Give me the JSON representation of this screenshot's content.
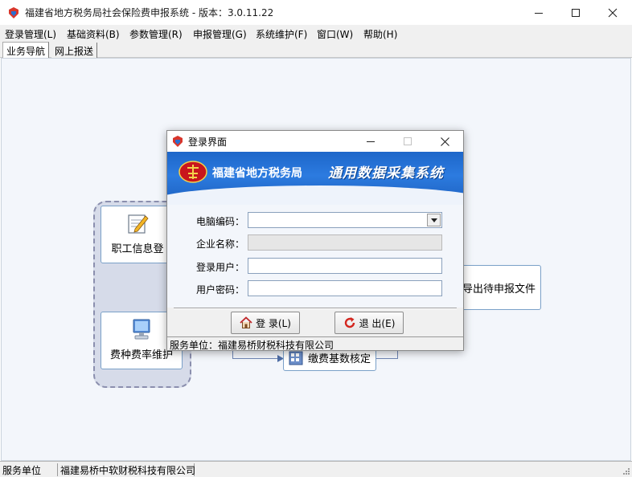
{
  "window": {
    "title": "福建省地方税务局社会保险费申报系统 - 版本：3.0.11.22"
  },
  "menu": [
    {
      "label": "登录管理(L)"
    },
    {
      "label": "基础资料(B)"
    },
    {
      "label": "参数管理(R)"
    },
    {
      "label": "申报管理(G)"
    },
    {
      "label": "系统维护(F)"
    },
    {
      "label": "窗口(W)"
    },
    {
      "label": "帮助(H)"
    }
  ],
  "tabs": [
    {
      "label": "业务导航",
      "active": true
    },
    {
      "label": "网上报送",
      "active": false
    }
  ],
  "workspace": {
    "buttons": {
      "employee_info": "职工信息登",
      "fee_rate": "费种费率维护",
      "export_file": "导出待申报文件",
      "base_check": "缴费基数核定"
    }
  },
  "statusbar": {
    "label": "服务单位",
    "value": "福建易桥中软财税科技有限公司"
  },
  "dialog": {
    "title": "登录界面",
    "banner_org": "福建省地方税务局",
    "banner_system": "通用数据采集系统",
    "fields": {
      "computer_code_label": "电脑编码：",
      "computer_code_value": "",
      "company_name_label": "企业名称：",
      "company_name_value": "",
      "login_user_label": "登录用户：",
      "login_user_value": "",
      "password_label": "用户密码：",
      "password_value": ""
    },
    "login_button": "登 录(L)",
    "exit_button": "退 出(E)",
    "status": "服务单位：福建易桥财税科技有限公司"
  },
  "colors": {
    "banner_blue": "#1d66c9",
    "workspace_bg": "#f3f6fb",
    "group_bg": "#d6dbe9"
  }
}
